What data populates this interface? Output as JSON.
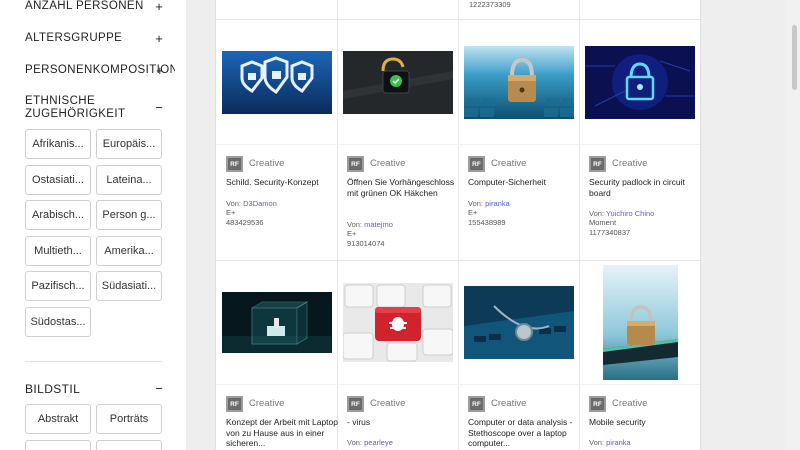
{
  "sidebar": {
    "facets": [
      {
        "label": "ANZAHL PERSONEN",
        "toggle": "+"
      },
      {
        "label": "ALTERSGRUPPE",
        "toggle": "+"
      },
      {
        "label": "PERSONENKOMPOSITION",
        "toggle": "+"
      },
      {
        "label": "ETHNISCHE ZUGEHÖRIGKEIT",
        "toggle": "−"
      }
    ],
    "ethnic_chips": [
      "Afrikanis...",
      "Europäis...",
      "Ostasiati...",
      "Lateina...",
      "Arabisch...",
      "Person g...",
      "Multieth...",
      "Amerika...",
      "Pazifisch...",
      "Südasiati...",
      "Südostas..."
    ],
    "bildstil": {
      "label": "BILDSTIL",
      "toggle": "−",
      "chips": [
        "Abstrakt",
        "Porträts"
      ]
    }
  },
  "top_row": {
    "id": "1222373309"
  },
  "results": [
    {
      "license": "RF",
      "type": "Creative",
      "title": "Schild. Security-Konzept",
      "by": "Von:",
      "author": "D3Damon",
      "collection": "E+",
      "id": "483429536",
      "image": "shield-locks-image"
    },
    {
      "license": "RF",
      "type": "Creative",
      "title": "Öffnen Sie Vorhängeschloss mit grünen OK Häkchen",
      "by": "Von:",
      "author": "matejmo",
      "collection": "E+",
      "id": "913014074",
      "image": "open-padlock-image"
    },
    {
      "license": "RF",
      "type": "Creative",
      "title": "Computer-Sicherheit",
      "by": "Von:",
      "author": "piranka",
      "collection": "E+",
      "id": "155438989",
      "image": "padlock-keyboard-image"
    },
    {
      "license": "RF",
      "type": "Creative",
      "title": "Security padlock in circuit board",
      "by": "Von:",
      "author": "Yuichiro Chino",
      "collection": "Moment",
      "id": "1177340837",
      "image": "circuit-padlock-image"
    },
    {
      "license": "RF",
      "type": "Creative",
      "title": "Konzept der Arbeit mit Laptop von zu Hause aus in einer sicheren...",
      "by": "",
      "author": "",
      "collection": "",
      "id": "",
      "image": "glass-cube-laptop-image"
    },
    {
      "license": "RF",
      "type": "Creative",
      "title": "- virus",
      "by": "Von:",
      "author": "pearleye",
      "collection": "",
      "id": "",
      "image": "virus-key-image"
    },
    {
      "license": "RF",
      "type": "Creative",
      "title": "Computer or data analysis - Stethoscope over a laptop computer...",
      "by": "",
      "author": "",
      "collection": "",
      "id": "",
      "image": "stethoscope-laptop-image"
    },
    {
      "license": "RF",
      "type": "Creative",
      "title": "Mobile security",
      "by": "Von:",
      "author": "piranka",
      "collection": "",
      "id": "",
      "image": "mobile-padlock-image"
    }
  ]
}
